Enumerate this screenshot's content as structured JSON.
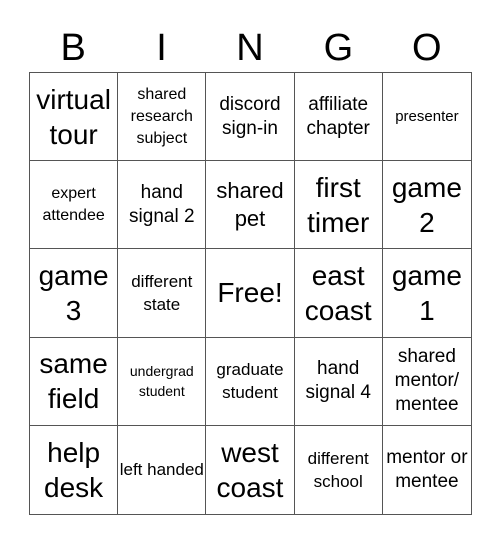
{
  "header": {
    "letters": [
      "B",
      "I",
      "N",
      "G",
      "O"
    ]
  },
  "card": {
    "rows": [
      [
        "virtual tour",
        "shared research subject",
        "discord sign-in",
        "affiliate chapter",
        "presenter"
      ],
      [
        "expert attendee",
        "hand signal 2",
        "shared pet",
        "first timer",
        "game 2"
      ],
      [
        "game 3",
        "different state",
        "Free!",
        "east coast",
        "game 1"
      ],
      [
        "same field",
        "undergrad student",
        "graduate student",
        "hand signal 4",
        "shared mentor/ mentee"
      ],
      [
        "help desk",
        "left handed",
        "west coast",
        "different school",
        "mentor or mentee"
      ]
    ],
    "free_space": "Free!"
  }
}
